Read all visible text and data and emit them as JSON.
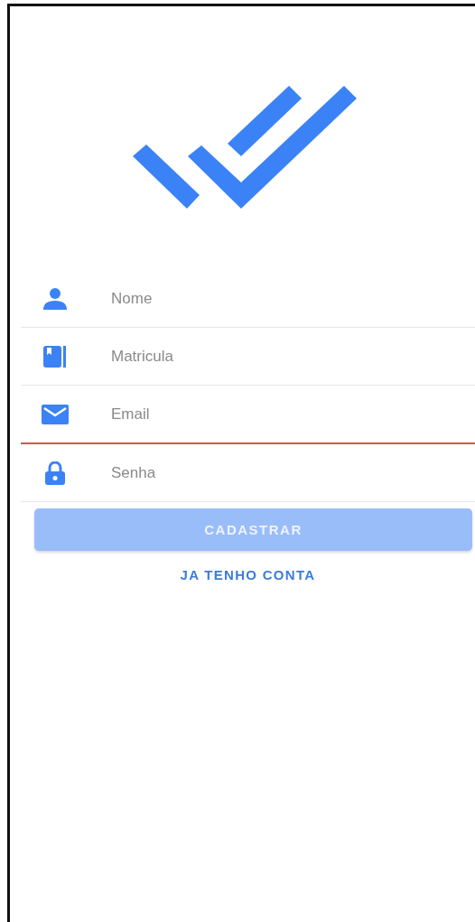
{
  "fields": [
    {
      "kind": "person",
      "placeholder": "Nome",
      "error": false
    },
    {
      "kind": "book",
      "placeholder": "Matricula",
      "error": false
    },
    {
      "kind": "mail",
      "placeholder": "Email",
      "error": true
    },
    {
      "kind": "lock",
      "placeholder": "Senha",
      "error": false
    }
  ],
  "submit_button": {
    "label": "CADASTRAR",
    "disabled": true
  },
  "login_link": {
    "label": "JA TENHO CONTA"
  }
}
